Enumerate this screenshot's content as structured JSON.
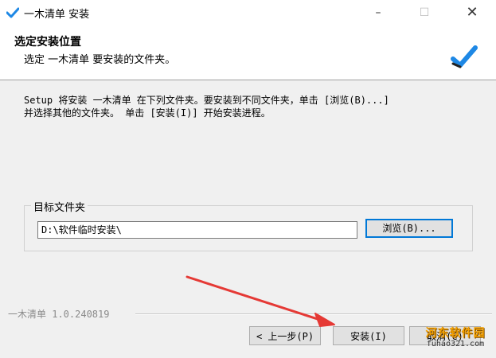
{
  "window": {
    "title": "一木清单 安装",
    "minimize_icon": "minimize-icon",
    "maximize_icon": "maximize-icon",
    "close_icon": "close-icon"
  },
  "header": {
    "title": "选定安装位置",
    "subtitle": "选定 一木清单 要安装的文件夹。"
  },
  "body": {
    "description": "Setup 将安装 一木清单 在下列文件夹。要安装到不同文件夹，单击 [浏览(B)...]\n并选择其他的文件夹。 单击 [安装(I)] 开始安装进程。"
  },
  "destination": {
    "group_label": "目标文件夹",
    "path_value": "D:\\软件临时安装\\",
    "browse_label": "浏览(B)..."
  },
  "footer": {
    "version_text": "一木清单 1.0.240819",
    "back_label": "< 上一步(P)",
    "install_label": "安装(I)",
    "cancel_label": "取消(C)"
  },
  "watermark": {
    "line1": "河东软件园",
    "line2": "fuhao321.com"
  },
  "colors": {
    "accent": "#0078d7",
    "arrow": "#e53935",
    "logo_blue": "#1e88e5"
  }
}
